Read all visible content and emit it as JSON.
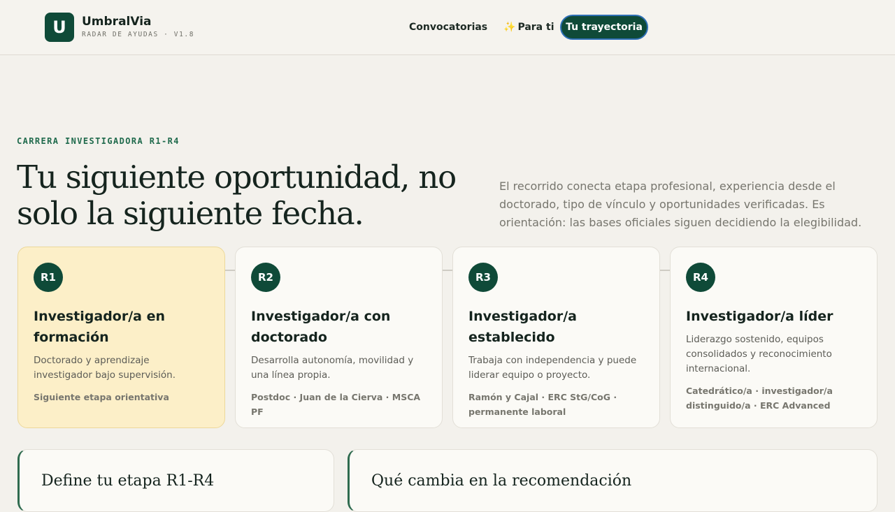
{
  "header": {
    "brand_letter": "U",
    "brand_name": "UmbralVia",
    "brand_sub": "RADAR DE AYUDAS · V1.8",
    "nav": {
      "convocatorias": "Convocatorias",
      "para_ti_icon": "✨",
      "para_ti": "Para ti",
      "trayectoria": "Tu trayectoria"
    }
  },
  "hero": {
    "eyebrow": "CARRERA INVESTIGADORA R1-R4",
    "title": "Tu siguiente oportunidad, no solo la siguiente fecha.",
    "description": "El recorrido conecta etapa profesional, experiencia desde el doctorado, tipo de vínculo y oportunidades verificadas. Es orientación: las bases oficiales siguen decidiendo la elegibilidad."
  },
  "stages": [
    {
      "badge": "R1",
      "title": "Investigador/a en formación",
      "description": "Doctorado y aprendizaje investigador bajo supervisión.",
      "meta": "Siguiente etapa orientativa"
    },
    {
      "badge": "R2",
      "title": "Investigador/a con doctorado",
      "description": "Desarrolla autonomía, movilidad y una línea propia.",
      "meta": "Postdoc · Juan de la Cierva · MSCA PF"
    },
    {
      "badge": "R3",
      "title": "Investigador/a establecido",
      "description": "Trabaja con independencia y puede liderar equipo o proyecto.",
      "meta": "Ramón y Cajal · ERC StG/CoG · permanente laboral"
    },
    {
      "badge": "R4",
      "title": "Investigador/a líder",
      "description": "Liderazgo sostenido, equipos consolidados y reconocimiento internacional.",
      "meta": "Catedrático/a · investigador/a distinguido/a · ERC Advanced"
    }
  ],
  "panels": {
    "define": "Define tu etapa R1-R4",
    "cambia": "Qué cambia en la recomendación"
  },
  "colors": {
    "brand": "#0f4a38",
    "accent_active_card": "#fcefc8",
    "eyebrow": "#1f6a4c"
  }
}
